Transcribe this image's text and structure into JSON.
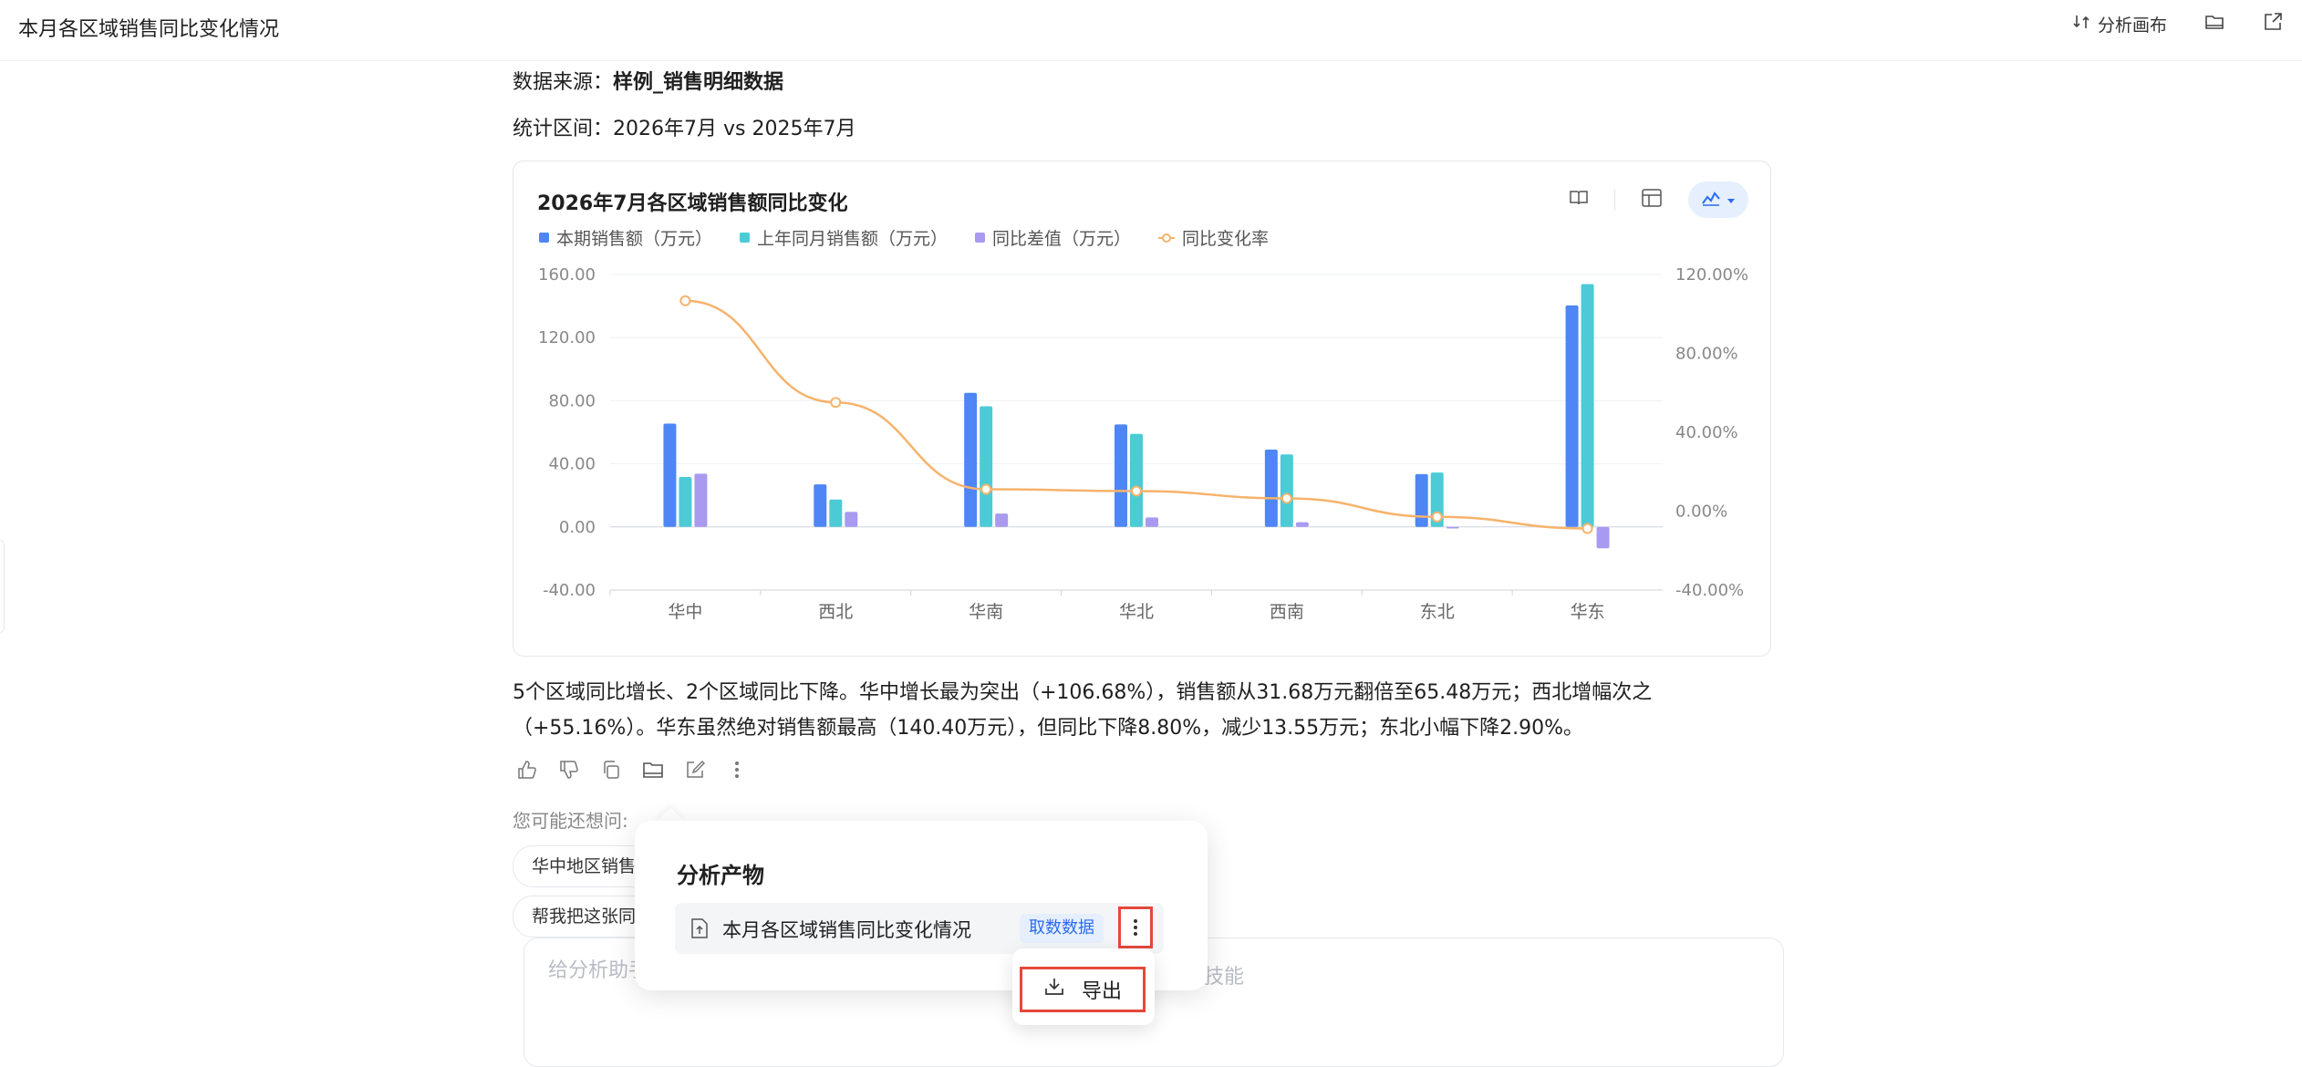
{
  "header": {
    "title": "本月各区域销售同比变化情况",
    "canvas_label": "分析画布"
  },
  "meta": {
    "source_label": "数据来源：",
    "source_value": "样例_销售明细数据",
    "period": "统计区间：2026年7月 vs 2025年7月"
  },
  "legend": [
    "本期销售额（万元）",
    "上年同月销售额（万元）",
    "同比差值（万元）",
    "同比变化率"
  ],
  "colors": {
    "current": "#4e86f5",
    "last_year": "#4ccbd6",
    "diff": "#a99af0",
    "rate": "#f6b36b",
    "accent": "#2b6bf3",
    "highlight": "#e5483b"
  },
  "chart_data": {
    "type": "bar",
    "title": "2026年7月各区域销售额同比变化",
    "categories": [
      "华中",
      "西北",
      "华南",
      "华北",
      "西南",
      "东北",
      "华东"
    ],
    "series": [
      {
        "name": "本期销售额（万元）",
        "values": [
          65.48,
          27.0,
          85.0,
          65.0,
          49.0,
          33.5,
          140.4
        ]
      },
      {
        "name": "上年同月销售额（万元）",
        "values": [
          31.68,
          17.4,
          76.5,
          59.0,
          46.0,
          34.5,
          153.95
        ]
      },
      {
        "name": "同比差值（万元）",
        "values": [
          33.8,
          9.6,
          8.5,
          6.0,
          3.0,
          -1.0,
          -13.55
        ]
      },
      {
        "name": "同比变化率",
        "axis": "right",
        "values": [
          106.68,
          55.16,
          11.1,
          10.2,
          6.5,
          -2.9,
          -8.8
        ]
      }
    ],
    "ylim": [
      -40,
      160
    ],
    "y_ticks": [
      "160.00",
      "120.00",
      "80.00",
      "40.00",
      "0.00",
      "-40.00"
    ],
    "y2lim": [
      -40,
      120
    ],
    "y2_ticks": [
      "120.00%",
      "80.00%",
      "40.00%",
      "0.00%",
      "-40.00%"
    ],
    "legend_position": "top-left",
    "grid": true
  },
  "summary": {
    "line1": "5个区域同比增长、2个区域同比下降。华中增长最为突出（+106.68%），销售额从31.68万元翻倍至65.48万元；西北增幅次之",
    "line2": "（+55.16%）。华东虽然绝对销售额最高（140.40万元），但同比下降8.80%，减少13.55万元；东北小幅下降2.90%。"
  },
  "suggestions": {
    "label": "您可能还想问:",
    "items": [
      "华中地区销售",
      "帮我把这张同"
    ]
  },
  "input": {
    "placeholder": "给分析助手",
    "tail": "技能"
  },
  "popover": {
    "title": "分析产物",
    "artifact_name": "本月各区域销售同比变化情况",
    "artifact_tag": "取数数据",
    "export_label": "导出"
  }
}
